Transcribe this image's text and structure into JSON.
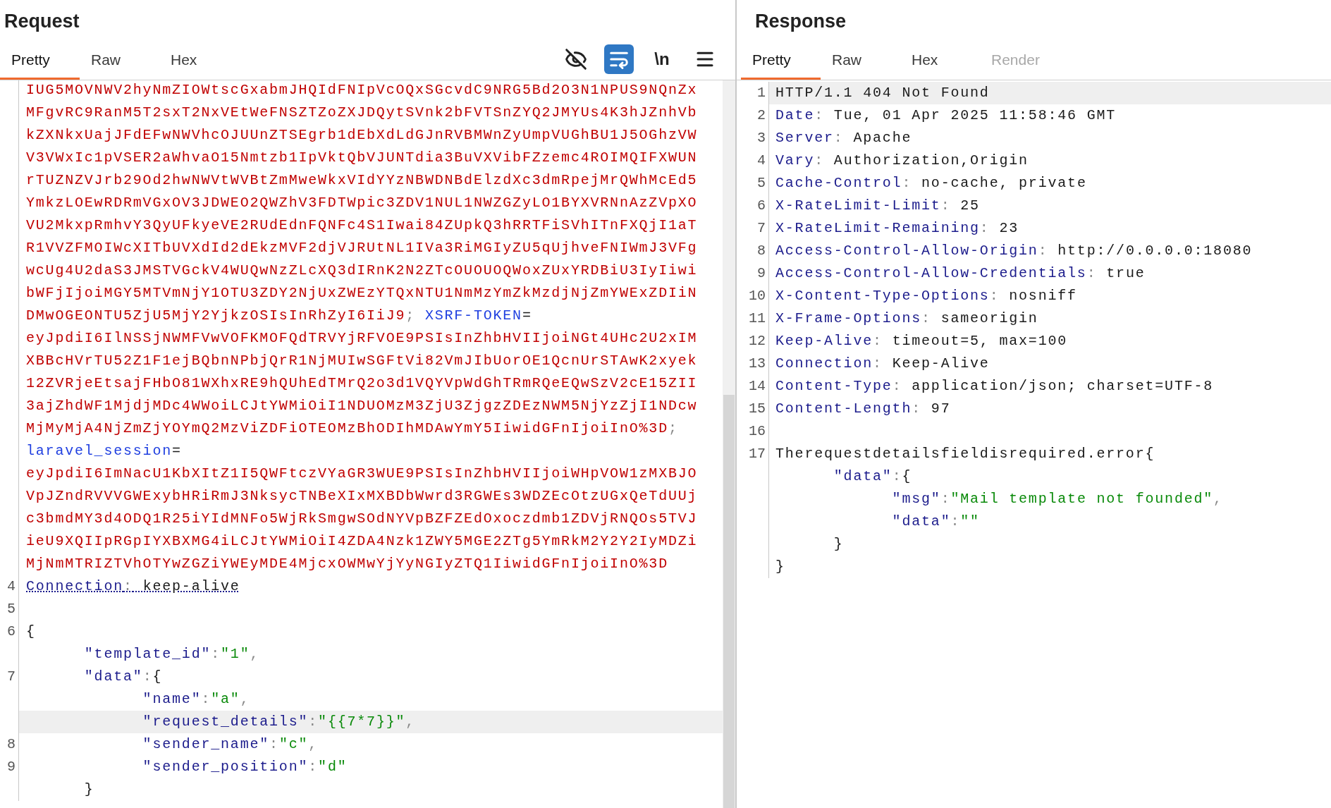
{
  "request": {
    "title": "Request",
    "tabs": [
      {
        "label": "Pretty",
        "selected": true,
        "disabled": false
      },
      {
        "label": "Raw",
        "selected": false,
        "disabled": false
      },
      {
        "label": "Hex",
        "selected": false,
        "disabled": false
      }
    ],
    "toolbar": [
      {
        "kind": "hide",
        "on": false
      },
      {
        "kind": "wrap",
        "on": true
      },
      {
        "kind": "newline",
        "label": "\\n",
        "on": false
      },
      {
        "kind": "menu",
        "on": false
      }
    ],
    "lines": [
      {
        "highlighted": false,
        "parts": [
          {
            "kind": "value",
            "text": "IUG5MOVNWV2hyNmZIOWtscGxabmJHQIdFNIpVcOQxSGcvdC9NRG5Bd2O3N1NPUS9NQnZx"
          }
        ]
      },
      {
        "highlighted": false,
        "parts": [
          {
            "kind": "value",
            "text": "MFgvRC9RanM5T2sxT2NxVEtWeFNSZTZoZXJDQytSVnk2bFVTSnZYQ2JMYUs4K3hJZnhVb"
          }
        ]
      },
      {
        "highlighted": false,
        "parts": [
          {
            "kind": "value",
            "text": "kZXNkxUajJFdEFwNWVhcOJUUnZTSEgrb1dEbXdLdGJnRVBMWnZyUmpVUGhBU1J5OGhzVW"
          }
        ]
      },
      {
        "highlighted": false,
        "parts": [
          {
            "kind": "value",
            "text": "V3VWxIc1pVSER2aWhvaO15Nmtzb1IpVktQbVJUNTdia3BuVXVibFZzemc4ROIMQIFXWUN"
          }
        ]
      },
      {
        "highlighted": false,
        "parts": [
          {
            "kind": "value",
            "text": "rTUZNZVJrb29Od2hwNWVtWVBtZmMweWkxVIdYYzNBWDNBdElzdXc3dmRpejMrQWhMcEd5"
          }
        ]
      },
      {
        "highlighted": false,
        "parts": [
          {
            "kind": "value",
            "text": "YmkzLOEwRDRmVGxOV3JDWEO2QWZhV3FDTWpic3ZDV1NUL1NWZGZyLO1BYXVRNnAzZVpXO"
          }
        ]
      },
      {
        "highlighted": false,
        "parts": [
          {
            "kind": "value",
            "text": "VU2MkxpRmhvY3QyUFkyeVE2RUdEdnFQNFc4S1Iwai84ZUpkQ3hRRTFiSVhITnFXQjI1aT"
          }
        ]
      },
      {
        "highlighted": false,
        "parts": [
          {
            "kind": "value",
            "text": "R1VVZFMOIWcXITbUVXdId2dEkzMVF2djVJRUtNL1IVa3RiMGIyZU5qUjhveFNIWmJ3VFg"
          }
        ]
      },
      {
        "highlighted": false,
        "parts": [
          {
            "kind": "value",
            "text": "wcUg4U2daS3JMSTVGckV4WUQwNzZLcXQ3dIRnK2N2ZTcOUOUOQWoxZUxYRDBiU3IyIiwi"
          }
        ]
      },
      {
        "highlighted": false,
        "parts": [
          {
            "kind": "value",
            "text": "bWFjIjoiMGY5MTVmNjY1OTU3ZDY2NjUxZWEzYTQxNTU1NmMzYmZkMzdjNjZmYWExZDIiN"
          }
        ]
      },
      {
        "highlighted": false,
        "parts": [
          {
            "kind": "value",
            "text": "DMwOGEONTU5ZjU5MjY2YjkzOSIsInRhZyI6IiJ9"
          },
          {
            "kind": "punct",
            "text": "; "
          },
          {
            "kind": "cookie",
            "text": "XSRF-TOKEN"
          },
          {
            "kind": "plain",
            "text": "="
          }
        ]
      },
      {
        "highlighted": false,
        "parts": [
          {
            "kind": "value",
            "text": "eyJpdiI6IlNSSjNWMFVwVOFKMOFQdTRVYjRFVOE9PSIsInZhbHVIIjoiNGt4UHc2U2xIM"
          }
        ]
      },
      {
        "highlighted": false,
        "parts": [
          {
            "kind": "value",
            "text": "XBBcHVrTU52Z1F1ejBQbnNPbjQrR1NjMUIwSGFtVi82VmJIbUorOE1QcnUrSTAwK2xyek"
          }
        ]
      },
      {
        "highlighted": false,
        "parts": [
          {
            "kind": "value",
            "text": "12ZVRjeEtsajFHbO81WXhxRE9hQUhEdTMrQ2o3d1VQYVpWdGhTRmRQeEQwSzV2cE15ZII"
          }
        ]
      },
      {
        "highlighted": false,
        "parts": [
          {
            "kind": "value",
            "text": "3ajZhdWF1MjdjMDc4WWoiLCJtYWMiOiI1NDUOMzM3ZjU3ZjgzZDEzNWM5NjYzZjI1NDcw"
          }
        ]
      },
      {
        "highlighted": false,
        "parts": [
          {
            "kind": "value",
            "text": "MjMyMjA4NjZmZjYOYmQ2MzViZDFiOTEOMzBhODIhMDAwYmY5IiwidGFnIjoiInO%3D"
          },
          {
            "kind": "punct",
            "text": ";"
          }
        ]
      },
      {
        "highlighted": false,
        "parts": [
          {
            "kind": "cookie",
            "text": "laravel_session"
          },
          {
            "kind": "plain",
            "text": "="
          }
        ]
      },
      {
        "highlighted": false,
        "parts": [
          {
            "kind": "value",
            "text": "eyJpdiI6ImNacU1KbXItZ1I5QWFtczVYaGR3WUE9PSIsInZhbHVIIjoiWHpVOW1zMXBJO"
          }
        ]
      },
      {
        "highlighted": false,
        "parts": [
          {
            "kind": "value",
            "text": "VpJZndRVVVGWExybHRiRmJ3NksycTNBeXIxMXBDbWwrd3RGWEs3WDZEcOtzUGxQeTdUUj"
          }
        ]
      },
      {
        "highlighted": false,
        "parts": [
          {
            "kind": "value",
            "text": "c3bmdMY3d4ODQ1R25iYIdMNFo5WjRkSmgwSOdNYVpBZFZEdOxoczdmb1ZDVjRNQOs5TVJ"
          }
        ]
      },
      {
        "highlighted": false,
        "parts": [
          {
            "kind": "value",
            "text": "ieU9XQIIpRGpIYXBXMG4iLCJtYWMiOiI4ZDA4Nzk1ZWY5MGE2ZTg5YmRkM2Y2Y2IyMDZi"
          }
        ]
      },
      {
        "highlighted": false,
        "parts": [
          {
            "kind": "value",
            "text": "MjNmMTRIZTVhOTYwZGZiYWEyMDE4MjcxOWMwYjYyNGIyZTQ1IiwidGFnIjoiInO%3D"
          }
        ]
      },
      {
        "number": "4",
        "highlighted": false,
        "parts": [
          {
            "kind": "key_flagged",
            "text": "Connection"
          },
          {
            "kind": "punct_flagged",
            "text": ":"
          },
          {
            "kind": "plain_flagged",
            "text": " keep-alive"
          }
        ]
      },
      {
        "number": "5",
        "highlighted": false
      },
      {
        "number": "6",
        "highlighted": false,
        "parts": [
          {
            "kind": "plain",
            "text": "{"
          }
        ]
      },
      {
        "highlighted": false,
        "parts": [
          {
            "kind": "key",
            "text": "      \"template_id\""
          },
          {
            "kind": "punct",
            "text": ":"
          },
          {
            "kind": "string",
            "text": "\"1\""
          },
          {
            "kind": "punct",
            "text": ","
          }
        ]
      },
      {
        "number": "7",
        "highlighted": false,
        "parts": [
          {
            "kind": "key",
            "text": "      \"data\""
          },
          {
            "kind": "punct",
            "text": ":"
          },
          {
            "kind": "plain",
            "text": "{"
          }
        ]
      },
      {
        "highlighted": false,
        "parts": [
          {
            "kind": "key",
            "text": "            \"name\""
          },
          {
            "kind": "punct",
            "text": ":"
          },
          {
            "kind": "string",
            "text": "\"a\""
          },
          {
            "kind": "punct",
            "text": ","
          }
        ]
      },
      {
        "highlighted": true,
        "parts": [
          {
            "kind": "key",
            "text": "            \"request_details\""
          },
          {
            "kind": "punct",
            "text": ":"
          },
          {
            "kind": "string",
            "text": "\"{{7*7}}\""
          },
          {
            "kind": "punct",
            "text": ","
          }
        ]
      },
      {
        "number": "8",
        "highlighted": false,
        "parts": [
          {
            "kind": "key",
            "text": "            \"sender_name\""
          },
          {
            "kind": "punct",
            "text": ":"
          },
          {
            "kind": "string",
            "text": "\"c\""
          },
          {
            "kind": "punct",
            "text": ","
          }
        ]
      },
      {
        "number": "9",
        "highlighted": false,
        "parts": [
          {
            "kind": "key",
            "text": "            \"sender_position\""
          },
          {
            "kind": "punct",
            "text": ":"
          },
          {
            "kind": "string",
            "text": "\"d\""
          }
        ]
      },
      {
        "highlighted": false,
        "parts": [
          {
            "kind": "plain",
            "text": "      }"
          }
        ]
      }
    ]
  },
  "response": {
    "title": "Response",
    "tabs": [
      {
        "label": "Pretty",
        "selected": true,
        "disabled": false
      },
      {
        "label": "Raw",
        "selected": false,
        "disabled": false
      },
      {
        "label": "Hex",
        "selected": false,
        "disabled": false
      },
      {
        "label": "Render",
        "selected": false,
        "disabled": true
      }
    ],
    "lines": [
      {
        "number": "1",
        "highlighted": true,
        "parts": [
          {
            "kind": "plain",
            "text": "HTTP/1.1 404 Not Found"
          }
        ]
      },
      {
        "number": "2",
        "highlighted": false,
        "parts": [
          {
            "kind": "key",
            "text": "Date"
          },
          {
            "kind": "punct",
            "text": ":"
          },
          {
            "kind": "plain",
            "text": " Tue, 01 Apr 2025 11:58:46 GMT"
          }
        ]
      },
      {
        "number": "3",
        "highlighted": false,
        "parts": [
          {
            "kind": "key",
            "text": "Server"
          },
          {
            "kind": "punct",
            "text": ":"
          },
          {
            "kind": "plain",
            "text": " Apache"
          }
        ]
      },
      {
        "number": "4",
        "highlighted": false,
        "parts": [
          {
            "kind": "key",
            "text": "Vary"
          },
          {
            "kind": "punct",
            "text": ":"
          },
          {
            "kind": "plain",
            "text": " Authorization,Origin"
          }
        ]
      },
      {
        "number": "5",
        "highlighted": false,
        "parts": [
          {
            "kind": "key",
            "text": "Cache-Control"
          },
          {
            "kind": "punct",
            "text": ":"
          },
          {
            "kind": "plain",
            "text": " no-cache, private"
          }
        ]
      },
      {
        "number": "6",
        "highlighted": false,
        "parts": [
          {
            "kind": "key",
            "text": "X-RateLimit-Limit"
          },
          {
            "kind": "punct",
            "text": ":"
          },
          {
            "kind": "plain",
            "text": " 25"
          }
        ]
      },
      {
        "number": "7",
        "highlighted": false,
        "parts": [
          {
            "kind": "key",
            "text": "X-RateLimit-Remaining"
          },
          {
            "kind": "punct",
            "text": ":"
          },
          {
            "kind": "plain",
            "text": " 23"
          }
        ]
      },
      {
        "number": "8",
        "highlighted": false,
        "parts": [
          {
            "kind": "key",
            "text": "Access-Control-Allow-Origin"
          },
          {
            "kind": "punct",
            "text": ":"
          },
          {
            "kind": "plain",
            "text": " http://0.0.0.0:18080"
          }
        ]
      },
      {
        "number": "9",
        "highlighted": false,
        "parts": [
          {
            "kind": "key",
            "text": "Access-Control-Allow-Credentials"
          },
          {
            "kind": "punct",
            "text": ":"
          },
          {
            "kind": "plain",
            "text": " true"
          }
        ]
      },
      {
        "number": "10",
        "highlighted": false,
        "parts": [
          {
            "kind": "key",
            "text": "X-Content-Type-Options"
          },
          {
            "kind": "punct",
            "text": ":"
          },
          {
            "kind": "plain",
            "text": " nosniff"
          }
        ]
      },
      {
        "number": "11",
        "highlighted": false,
        "parts": [
          {
            "kind": "key",
            "text": "X-Frame-Options"
          },
          {
            "kind": "punct",
            "text": ":"
          },
          {
            "kind": "plain",
            "text": " sameorigin"
          }
        ]
      },
      {
        "number": "12",
        "highlighted": false,
        "parts": [
          {
            "kind": "key",
            "text": "Keep-Alive"
          },
          {
            "kind": "punct",
            "text": ":"
          },
          {
            "kind": "plain",
            "text": " timeout=5, max=100"
          }
        ]
      },
      {
        "number": "13",
        "highlighted": false,
        "parts": [
          {
            "kind": "key",
            "text": "Connection"
          },
          {
            "kind": "punct",
            "text": ":"
          },
          {
            "kind": "plain",
            "text": " Keep-Alive"
          }
        ]
      },
      {
        "number": "14",
        "highlighted": false,
        "parts": [
          {
            "kind": "key",
            "text": "Content-Type"
          },
          {
            "kind": "punct",
            "text": ":"
          },
          {
            "kind": "plain",
            "text": " application/json; charset=UTF-8"
          }
        ]
      },
      {
        "number": "15",
        "highlighted": false,
        "parts": [
          {
            "kind": "key",
            "text": "Content-Length"
          },
          {
            "kind": "punct",
            "text": ":"
          },
          {
            "kind": "plain",
            "text": " 97"
          }
        ]
      },
      {
        "number": "16",
        "highlighted": false
      },
      {
        "number": "17",
        "highlighted": false,
        "parts": [
          {
            "kind": "plain",
            "text": "Therequestdetailsfieldisrequired.error{"
          }
        ]
      },
      {
        "highlighted": false,
        "parts": [
          {
            "kind": "key",
            "text": "      \"data\""
          },
          {
            "kind": "punct",
            "text": ":"
          },
          {
            "kind": "plain",
            "text": "{"
          }
        ]
      },
      {
        "highlighted": false,
        "parts": [
          {
            "kind": "key",
            "text": "            \"msg\""
          },
          {
            "kind": "punct",
            "text": ":"
          },
          {
            "kind": "string",
            "text": "\"Mail template not founded\""
          },
          {
            "kind": "punct",
            "text": ","
          }
        ]
      },
      {
        "highlighted": false,
        "parts": [
          {
            "kind": "key",
            "text": "            \"data\""
          },
          {
            "kind": "punct",
            "text": ":"
          },
          {
            "kind": "string",
            "text": "\"\""
          }
        ]
      },
      {
        "highlighted": false,
        "parts": [
          {
            "kind": "plain",
            "text": "      }"
          }
        ]
      },
      {
        "highlighted": false,
        "parts": [
          {
            "kind": "plain",
            "text": "}"
          }
        ]
      }
    ]
  }
}
